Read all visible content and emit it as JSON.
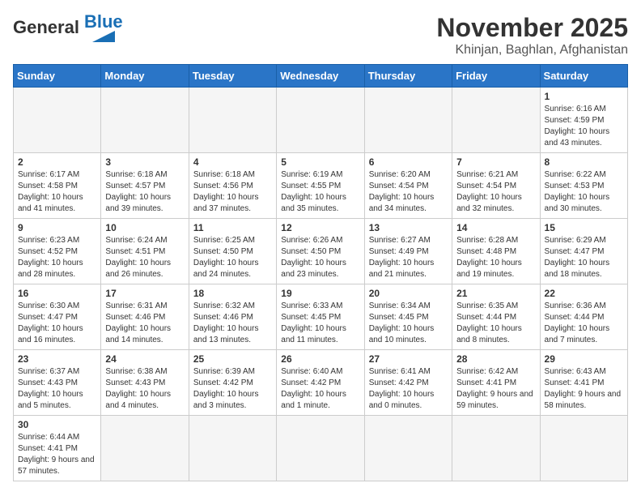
{
  "logo": {
    "general": "General",
    "blue": "Blue"
  },
  "header": {
    "month": "November 2025",
    "location": "Khinjan, Baghlan, Afghanistan"
  },
  "weekdays": [
    "Sunday",
    "Monday",
    "Tuesday",
    "Wednesday",
    "Thursday",
    "Friday",
    "Saturday"
  ],
  "rows": [
    [
      {
        "day": "",
        "info": ""
      },
      {
        "day": "",
        "info": ""
      },
      {
        "day": "",
        "info": ""
      },
      {
        "day": "",
        "info": ""
      },
      {
        "day": "",
        "info": ""
      },
      {
        "day": "",
        "info": ""
      },
      {
        "day": "1",
        "info": "Sunrise: 6:16 AM\nSunset: 4:59 PM\nDaylight: 10 hours and 43 minutes."
      }
    ],
    [
      {
        "day": "2",
        "info": "Sunrise: 6:17 AM\nSunset: 4:58 PM\nDaylight: 10 hours and 41 minutes."
      },
      {
        "day": "3",
        "info": "Sunrise: 6:18 AM\nSunset: 4:57 PM\nDaylight: 10 hours and 39 minutes."
      },
      {
        "day": "4",
        "info": "Sunrise: 6:18 AM\nSunset: 4:56 PM\nDaylight: 10 hours and 37 minutes."
      },
      {
        "day": "5",
        "info": "Sunrise: 6:19 AM\nSunset: 4:55 PM\nDaylight: 10 hours and 35 minutes."
      },
      {
        "day": "6",
        "info": "Sunrise: 6:20 AM\nSunset: 4:54 PM\nDaylight: 10 hours and 34 minutes."
      },
      {
        "day": "7",
        "info": "Sunrise: 6:21 AM\nSunset: 4:54 PM\nDaylight: 10 hours and 32 minutes."
      },
      {
        "day": "8",
        "info": "Sunrise: 6:22 AM\nSunset: 4:53 PM\nDaylight: 10 hours and 30 minutes."
      }
    ],
    [
      {
        "day": "9",
        "info": "Sunrise: 6:23 AM\nSunset: 4:52 PM\nDaylight: 10 hours and 28 minutes."
      },
      {
        "day": "10",
        "info": "Sunrise: 6:24 AM\nSunset: 4:51 PM\nDaylight: 10 hours and 26 minutes."
      },
      {
        "day": "11",
        "info": "Sunrise: 6:25 AM\nSunset: 4:50 PM\nDaylight: 10 hours and 24 minutes."
      },
      {
        "day": "12",
        "info": "Sunrise: 6:26 AM\nSunset: 4:50 PM\nDaylight: 10 hours and 23 minutes."
      },
      {
        "day": "13",
        "info": "Sunrise: 6:27 AM\nSunset: 4:49 PM\nDaylight: 10 hours and 21 minutes."
      },
      {
        "day": "14",
        "info": "Sunrise: 6:28 AM\nSunset: 4:48 PM\nDaylight: 10 hours and 19 minutes."
      },
      {
        "day": "15",
        "info": "Sunrise: 6:29 AM\nSunset: 4:47 PM\nDaylight: 10 hours and 18 minutes."
      }
    ],
    [
      {
        "day": "16",
        "info": "Sunrise: 6:30 AM\nSunset: 4:47 PM\nDaylight: 10 hours and 16 minutes."
      },
      {
        "day": "17",
        "info": "Sunrise: 6:31 AM\nSunset: 4:46 PM\nDaylight: 10 hours and 14 minutes."
      },
      {
        "day": "18",
        "info": "Sunrise: 6:32 AM\nSunset: 4:46 PM\nDaylight: 10 hours and 13 minutes."
      },
      {
        "day": "19",
        "info": "Sunrise: 6:33 AM\nSunset: 4:45 PM\nDaylight: 10 hours and 11 minutes."
      },
      {
        "day": "20",
        "info": "Sunrise: 6:34 AM\nSunset: 4:45 PM\nDaylight: 10 hours and 10 minutes."
      },
      {
        "day": "21",
        "info": "Sunrise: 6:35 AM\nSunset: 4:44 PM\nDaylight: 10 hours and 8 minutes."
      },
      {
        "day": "22",
        "info": "Sunrise: 6:36 AM\nSunset: 4:44 PM\nDaylight: 10 hours and 7 minutes."
      }
    ],
    [
      {
        "day": "23",
        "info": "Sunrise: 6:37 AM\nSunset: 4:43 PM\nDaylight: 10 hours and 5 minutes."
      },
      {
        "day": "24",
        "info": "Sunrise: 6:38 AM\nSunset: 4:43 PM\nDaylight: 10 hours and 4 minutes."
      },
      {
        "day": "25",
        "info": "Sunrise: 6:39 AM\nSunset: 4:42 PM\nDaylight: 10 hours and 3 minutes."
      },
      {
        "day": "26",
        "info": "Sunrise: 6:40 AM\nSunset: 4:42 PM\nDaylight: 10 hours and 1 minute."
      },
      {
        "day": "27",
        "info": "Sunrise: 6:41 AM\nSunset: 4:42 PM\nDaylight: 10 hours and 0 minutes."
      },
      {
        "day": "28",
        "info": "Sunrise: 6:42 AM\nSunset: 4:41 PM\nDaylight: 9 hours and 59 minutes."
      },
      {
        "day": "29",
        "info": "Sunrise: 6:43 AM\nSunset: 4:41 PM\nDaylight: 9 hours and 58 minutes."
      }
    ],
    [
      {
        "day": "30",
        "info": "Sunrise: 6:44 AM\nSunset: 4:41 PM\nDaylight: 9 hours and 57 minutes."
      },
      {
        "day": "",
        "info": ""
      },
      {
        "day": "",
        "info": ""
      },
      {
        "day": "",
        "info": ""
      },
      {
        "day": "",
        "info": ""
      },
      {
        "day": "",
        "info": ""
      },
      {
        "day": "",
        "info": ""
      }
    ]
  ]
}
